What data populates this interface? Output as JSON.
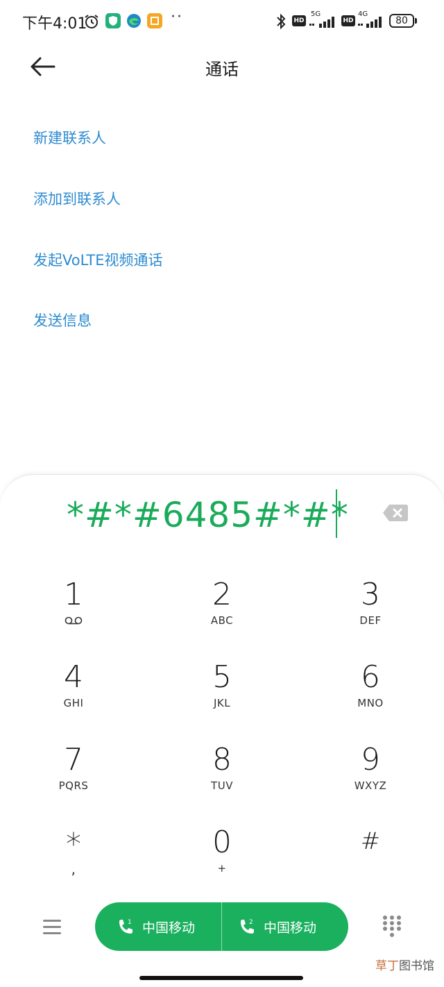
{
  "status_bar": {
    "time": "下午4:01",
    "icons": [
      "alarm-icon",
      "shield-app-icon",
      "edge-browser-icon",
      "notes-app-icon",
      "more-dots-icon",
      "bluetooth-icon"
    ],
    "dots": "··",
    "hd1": "HD",
    "net1": "5G",
    "hd2": "HD",
    "net2": "4G",
    "battery": "80"
  },
  "header": {
    "title": "通话",
    "back_icon": "arrow-left-icon"
  },
  "actions": [
    {
      "label": "新建联系人"
    },
    {
      "label": "添加到联系人"
    },
    {
      "label": "发起VoLTE视频通话"
    },
    {
      "label": "发送信息"
    }
  ],
  "dialer": {
    "number": "*#*#6485#*#*",
    "accent_color": "#1aab5a",
    "keys": [
      {
        "digit": "1",
        "letters": ""
      },
      {
        "digit": "2",
        "letters": "ABC"
      },
      {
        "digit": "3",
        "letters": "DEF"
      },
      {
        "digit": "4",
        "letters": "GHI"
      },
      {
        "digit": "5",
        "letters": "JKL"
      },
      {
        "digit": "6",
        "letters": "MNO"
      },
      {
        "digit": "7",
        "letters": "PQRS"
      },
      {
        "digit": "8",
        "letters": "TUV"
      },
      {
        "digit": "9",
        "letters": "WXYZ"
      },
      {
        "digit": "*",
        "letters": ","
      },
      {
        "digit": "0",
        "letters": "+"
      },
      {
        "digit": "#",
        "letters": ""
      }
    ]
  },
  "bottom": {
    "sim1": {
      "number": "1",
      "label": "中国移动"
    },
    "sim2": {
      "number": "2",
      "label": "中国移动"
    },
    "call_color": "#1ab05e"
  },
  "watermark": {
    "part1": "草丁",
    "part2": "图书馆"
  }
}
